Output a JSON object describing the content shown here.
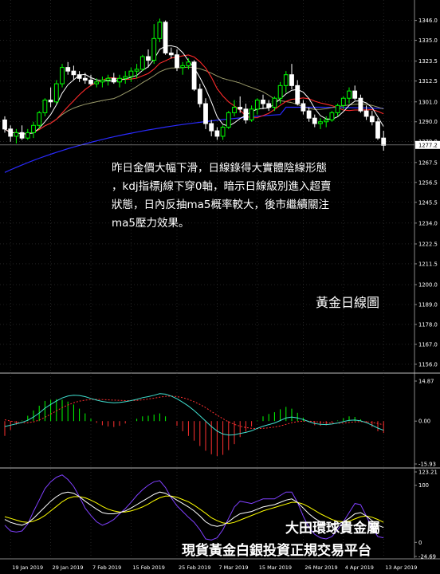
{
  "annotation": {
    "line1": "昨日金價大幅下滑，日線錄得大實體陰線形態",
    "line2": "，kdj指標j線下穿0軸，暗示日線級別進入超賣",
    "line3": "狀態，日內反抽ma5概率較大，後市繼續關注",
    "line4": "ma5壓力效果。"
  },
  "caption": "黃金日線圖",
  "brand": {
    "line1": "大田環球貴金屬",
    "line2": "現貨黃金白銀投資正規交易平台"
  },
  "colors": {
    "background": "#000000",
    "bull": "#00ff00",
    "bear": "#ffffff",
    "ma_fast": "#ffffff",
    "ma_mid": "#ff2a2a",
    "ma_slow": "#9a9a6a",
    "ma_long": "#2a2aff",
    "macd_line": "#40e0d0",
    "macd_signal": "#ff3030",
    "kdj_k": "#ffffff",
    "kdj_d": "#ffff00",
    "kdj_j": "#8040ff",
    "grid": "#3a3a3a",
    "current_price_bg": "#ffffff"
  },
  "chart_data": [
    {
      "type": "candlestick",
      "current_price": "1277.2",
      "ylim": [
        1152,
        1352
      ],
      "yticks": [
        "1346.0",
        "1335.0",
        "1323.5",
        "1312.5",
        "1301.0",
        "1290.0",
        "1279.0",
        "1267.5",
        "1256.5",
        "1245.5",
        "1234.0",
        "1222.5",
        "1211.5",
        "1200.0",
        "1189.0",
        "1178.0",
        "1167.0",
        "1156.0"
      ],
      "xticks": [
        "19 Jan 2019",
        "29 Jan 2019",
        "7 Feb 2019",
        "15 Feb 2019",
        "25 Feb 2019",
        "7 Mar 2019",
        "15 Mar 2019",
        "26 Mar 2019",
        "4 Apr 2019",
        "13 Apr 2019"
      ],
      "xtick_index": [
        1,
        8,
        15,
        22,
        30,
        37,
        44,
        52,
        59,
        66
      ],
      "ohlc": [
        [
          1291,
          1293,
          1284,
          1286
        ],
        [
          1286,
          1288,
          1279,
          1282
        ],
        [
          1282,
          1286,
          1278,
          1284
        ],
        [
          1284,
          1288,
          1280,
          1281
        ],
        [
          1281,
          1286,
          1280,
          1284
        ],
        [
          1284,
          1290,
          1281,
          1288
        ],
        [
          1288,
          1296,
          1286,
          1295
        ],
        [
          1295,
          1303,
          1293,
          1302
        ],
        [
          1302,
          1309,
          1298,
          1301
        ],
        [
          1301,
          1313,
          1300,
          1311
        ],
        [
          1311,
          1322,
          1309,
          1320
        ],
        [
          1320,
          1323,
          1316,
          1318
        ],
        [
          1318,
          1321,
          1313,
          1316
        ],
        [
          1316,
          1318,
          1312,
          1314
        ],
        [
          1314,
          1317,
          1311,
          1313
        ],
        [
          1313,
          1316,
          1310,
          1311
        ],
        [
          1311,
          1314,
          1309,
          1312
        ],
        [
          1312,
          1315,
          1309,
          1313
        ],
        [
          1313,
          1316,
          1310,
          1314
        ],
        [
          1314,
          1317,
          1311,
          1312
        ],
        [
          1312,
          1316,
          1309,
          1314
        ],
        [
          1314,
          1318,
          1311,
          1315
        ],
        [
          1315,
          1320,
          1312,
          1318
        ],
        [
          1318,
          1322,
          1314,
          1319
        ],
        [
          1319,
          1327,
          1318,
          1326
        ],
        [
          1326,
          1330,
          1320,
          1324
        ],
        [
          1324,
          1344,
          1322,
          1336
        ],
        [
          1336,
          1347,
          1334,
          1345
        ],
        [
          1345,
          1346,
          1327,
          1328
        ],
        [
          1328,
          1331,
          1325,
          1327
        ],
        [
          1327,
          1330,
          1318,
          1320
        ],
        [
          1320,
          1323,
          1316,
          1321
        ],
        [
          1321,
          1325,
          1319,
          1323
        ],
        [
          1323,
          1324,
          1307,
          1308
        ],
        [
          1308,
          1311,
          1298,
          1300
        ],
        [
          1300,
          1303,
          1286,
          1289
        ],
        [
          1289,
          1291,
          1282,
          1285
        ],
        [
          1285,
          1287,
          1280,
          1282
        ],
        [
          1282,
          1288,
          1280,
          1287
        ],
        [
          1287,
          1296,
          1286,
          1295
        ],
        [
          1295,
          1302,
          1293,
          1298
        ],
        [
          1298,
          1304,
          1295,
          1297
        ],
        [
          1297,
          1300,
          1289,
          1291
        ],
        [
          1291,
          1299,
          1290,
          1297
        ],
        [
          1297,
          1303,
          1294,
          1302
        ],
        [
          1302,
          1305,
          1297,
          1300
        ],
        [
          1300,
          1302,
          1296,
          1298
        ],
        [
          1298,
          1304,
          1296,
          1303
        ],
        [
          1303,
          1312,
          1300,
          1310
        ],
        [
          1310,
          1318,
          1306,
          1316
        ],
        [
          1316,
          1322,
          1308,
          1310
        ],
        [
          1310,
          1313,
          1299,
          1300
        ],
        [
          1300,
          1302,
          1294,
          1296
        ],
        [
          1296,
          1298,
          1290,
          1292
        ],
        [
          1292,
          1294,
          1287,
          1289
        ],
        [
          1289,
          1292,
          1286,
          1290
        ],
        [
          1290,
          1293,
          1287,
          1291
        ],
        [
          1291,
          1296,
          1290,
          1295
        ],
        [
          1295,
          1300,
          1293,
          1299
        ],
        [
          1299,
          1304,
          1297,
          1303
        ],
        [
          1303,
          1309,
          1300,
          1307
        ],
        [
          1307,
          1310,
          1302,
          1303
        ],
        [
          1303,
          1305,
          1295,
          1296
        ],
        [
          1296,
          1299,
          1291,
          1293
        ],
        [
          1293,
          1296,
          1288,
          1290
        ],
        [
          1290,
          1292,
          1280,
          1281
        ],
        [
          1281,
          1285,
          1274,
          1277
        ]
      ]
    },
    {
      "type": "macd",
      "ylim": [
        -15.93,
        14.87
      ],
      "yticks": [
        "14.87",
        "0.00",
        "-15.93"
      ],
      "macd": [
        -2.0,
        -1.5,
        -1.0,
        -0.5,
        0.3,
        1.5,
        3.0,
        4.8,
        6.2,
        7.5,
        8.6,
        9.3,
        9.6,
        9.5,
        9.1,
        8.4,
        7.8,
        7.3,
        7.0,
        6.8,
        6.9,
        7.2,
        7.6,
        8.1,
        8.7,
        9.1,
        9.6,
        10.2,
        10.0,
        9.3,
        8.3,
        7.0,
        5.6,
        3.9,
        2.0,
        0.0,
        -2.0,
        -3.7,
        -4.8,
        -5.2,
        -5.1,
        -4.6,
        -4.2,
        -3.6,
        -2.7,
        -1.9,
        -1.3,
        -0.7,
        0.2,
        1.2,
        1.5,
        1.2,
        0.6,
        -0.2,
        -0.9,
        -1.2,
        -1.3,
        -1.1,
        -0.7,
        -0.2,
        0.3,
        0.4,
        0.1,
        -0.6,
        -1.5,
        -2.6,
        -3.4
      ],
      "signal": [
        0.5,
        0.0,
        -0.4,
        -0.6,
        -0.6,
        -0.3,
        0.4,
        1.4,
        2.6,
        3.8,
        5.0,
        6.0,
        6.8,
        7.4,
        7.8,
        8.0,
        8.1,
        8.0,
        7.9,
        7.8,
        7.7,
        7.6,
        7.6,
        7.7,
        7.9,
        8.2,
        8.5,
        8.9,
        9.2,
        9.3,
        9.1,
        8.7,
        8.1,
        7.2,
        6.2,
        5.0,
        3.6,
        2.2,
        0.9,
        -0.3,
        -1.2,
        -1.9,
        -2.4,
        -2.7,
        -2.8,
        -2.7,
        -2.5,
        -2.2,
        -1.8,
        -1.2,
        -0.6,
        -0.2,
        0.0,
        0.0,
        -0.2,
        -0.4,
        -0.6,
        -0.8,
        -0.8,
        -0.7,
        -0.5,
        -0.3,
        -0.2,
        -0.3,
        -0.5,
        -0.9,
        -1.4
      ]
    },
    {
      "type": "kdj",
      "ylim": [
        -24.69,
        123.21
      ],
      "yticks": [
        "123.21",
        "100",
        "0",
        "-24.69"
      ],
      "k": [
        40,
        35,
        32,
        30,
        34,
        42,
        52,
        62,
        72,
        80,
        86,
        88,
        86,
        80,
        72,
        65,
        58,
        52,
        50,
        50,
        52,
        55,
        60,
        66,
        72,
        78,
        84,
        88,
        86,
        80,
        74,
        68,
        62,
        55,
        46,
        36,
        30,
        28,
        30,
        36,
        44,
        50,
        52,
        54,
        58,
        62,
        64,
        66,
        70,
        74,
        76,
        70,
        60,
        50,
        42,
        36,
        32,
        30,
        32,
        36,
        42,
        50,
        52,
        46,
        38,
        30,
        26
      ],
      "d": [
        45,
        42,
        39,
        36,
        35,
        37,
        41,
        47,
        55,
        63,
        71,
        77,
        80,
        80,
        78,
        74,
        69,
        63,
        58,
        55,
        53,
        53,
        55,
        58,
        62,
        67,
        73,
        78,
        81,
        81,
        79,
        75,
        71,
        65,
        58,
        51,
        43,
        38,
        34,
        33,
        35,
        39,
        43,
        47,
        51,
        55,
        58,
        61,
        64,
        67,
        70,
        70,
        67,
        62,
        56,
        50,
        45,
        40,
        37,
        36,
        37,
        41,
        45,
        46,
        44,
        40,
        35
      ],
      "j": [
        30,
        20,
        18,
        20,
        32,
        54,
        74,
        94,
        106,
        114,
        118,
        110,
        98,
        80,
        60,
        47,
        36,
        30,
        34,
        40,
        50,
        59,
        70,
        82,
        92,
        100,
        106,
        108,
        96,
        78,
        64,
        54,
        44,
        35,
        22,
        6,
        4,
        8,
        22,
        42,
        62,
        72,
        70,
        68,
        72,
        76,
        76,
        76,
        82,
        88,
        88,
        70,
        46,
        26,
        14,
        8,
        6,
        10,
        22,
        36,
        52,
        68,
        66,
        46,
        26,
        10,
        8
      ]
    }
  ]
}
